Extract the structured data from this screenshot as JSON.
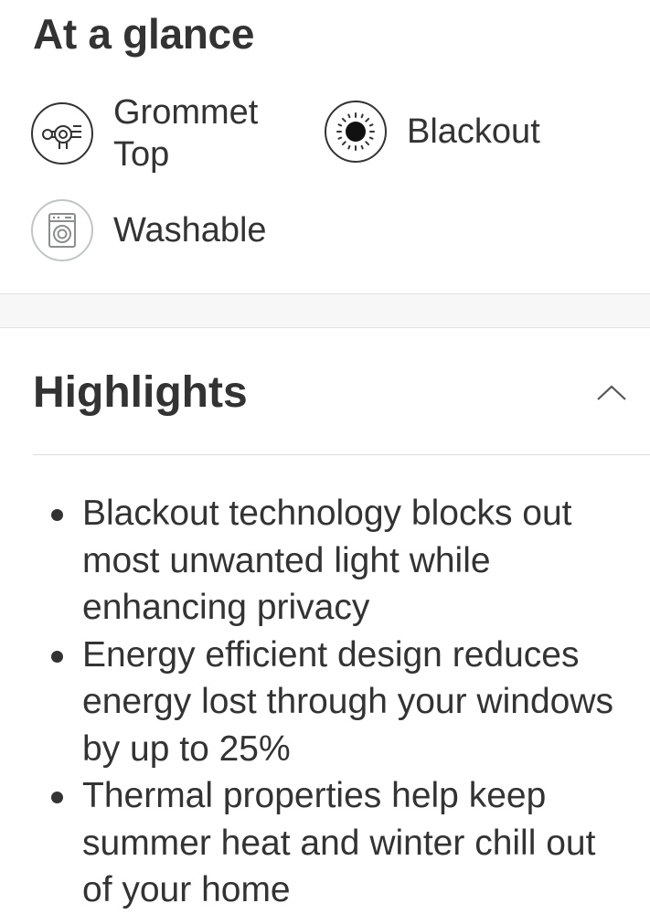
{
  "at_a_glance": {
    "title": "At a glance",
    "features": [
      {
        "label_line1": "Grommet",
        "label_line2": "Top",
        "icon": "grommet-rod-icon"
      },
      {
        "label": "Blackout",
        "icon": "blackout-sun-icon"
      },
      {
        "label": "Washable",
        "icon": "washing-machine-icon"
      }
    ]
  },
  "highlights": {
    "title": "Highlights",
    "toggle_icon": "chevron-up-icon",
    "expanded": true,
    "items": [
      "Blackout technology blocks out most unwanted light while enhancing privacy",
      "Energy efficient design reduces energy lost through your windows by up to 25%",
      "Thermal properties help keep summer heat and winter chill out of your home"
    ]
  },
  "colors": {
    "text": "#333333",
    "divider": "#dedede",
    "band": "#f7f7f7",
    "washable_icon_border": "#bfc6c4"
  }
}
